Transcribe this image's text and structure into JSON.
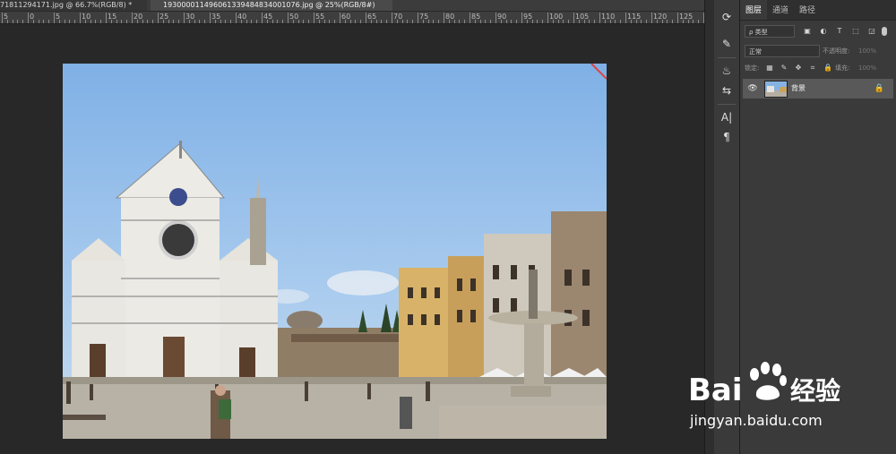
{
  "tabs": [
    {
      "label": "71811294171.jpg @ 66.7%(RGB/8) *"
    },
    {
      "label": "193000011496061339484834001076.jpg @ 25%(RGB/8#)"
    }
  ],
  "ruler": {
    "labels": [
      "5",
      "0",
      "5",
      "10",
      "15",
      "20",
      "25",
      "30",
      "35",
      "40",
      "45",
      "50",
      "55",
      "60",
      "65",
      "70",
      "75",
      "80",
      "85",
      "90",
      "95",
      "100",
      "105",
      "110",
      "115",
      "120",
      "125",
      "130"
    ]
  },
  "tools": {
    "icons": [
      "history-brush-icon",
      "brush-preset-icon",
      "puppet-icon",
      "adjust-icon",
      "character-icon",
      "paragraph-icon"
    ],
    "glyphs": [
      "⟳",
      "✎",
      "♨",
      "⇆",
      "A|",
      "¶"
    ]
  },
  "panel": {
    "tabs": [
      "图层",
      "通道",
      "路径"
    ],
    "filter_label": "ρ 类型",
    "blend_mode": "正常",
    "opacity_label": "不透明度:",
    "opacity_value": "100%",
    "lock_label": "锁定:",
    "fill_label": "填充:",
    "fill_value": "100%",
    "layer_name": "背景"
  },
  "watermark": {
    "brand": "Bai",
    "brand2": "经验",
    "url": "jingyan.baidu.com"
  }
}
